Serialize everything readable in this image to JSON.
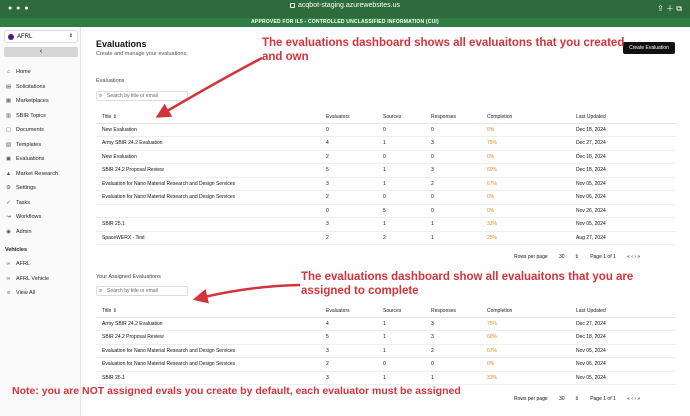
{
  "browser": {
    "url": "acqbot-staging.azurewebsites.us"
  },
  "banner": "APPROVED FOR IL5 - CONTROLLED UNCLASSIFIED INFORMATION (CUI)",
  "sidebar": {
    "org_name": "AFRL",
    "collapse_icon": "chevron-left",
    "items": [
      {
        "label": "Home",
        "icon": "home-icon"
      },
      {
        "label": "Solicitations",
        "icon": "document-icon"
      },
      {
        "label": "Marketplaces",
        "icon": "store-icon"
      },
      {
        "label": "SBIR Topics",
        "icon": "book-icon"
      },
      {
        "label": "Documents",
        "icon": "file-icon"
      },
      {
        "label": "Templates",
        "icon": "template-icon"
      },
      {
        "label": "Evaluations",
        "icon": "clipboard-icon"
      },
      {
        "label": "Market Research",
        "icon": "chart-icon"
      },
      {
        "label": "Settings",
        "icon": "gear-icon"
      },
      {
        "label": "Tasks",
        "icon": "check-icon"
      },
      {
        "label": "Workflows",
        "icon": "workflow-icon"
      },
      {
        "label": "Admin",
        "icon": "user-icon"
      }
    ],
    "vehicles_label": "Vehicles",
    "vehicles": [
      {
        "label": "AFRL",
        "icon": "link-icon"
      },
      {
        "label": "AFRL Vehicle",
        "icon": "link-icon"
      },
      {
        "label": "View All",
        "icon": "list-icon"
      }
    ]
  },
  "header": {
    "title": "Evaluations",
    "subtitle": "Create and manage your evaluations.",
    "create_button": "Create Evaluation"
  },
  "evaluations": {
    "label": "Evaluations",
    "search_placeholder": "Search by title or email",
    "columns": [
      "Title",
      "Evaluators",
      "Sources",
      "Responses",
      "Completion",
      "Last Updated"
    ],
    "rows": [
      [
        "New Evaluation",
        "0",
        "0",
        "0",
        "0%",
        "Dec 18, 2024"
      ],
      [
        "Army SBIR 24.2 Evaluation",
        "4",
        "1",
        "3",
        "75%",
        "Dec 27, 2024"
      ],
      [
        "New Evaluation",
        "2",
        "0",
        "0",
        "0%",
        "Dec 18, 2024"
      ],
      [
        "SBIR 24.2 Proposal Review",
        "5",
        "1",
        "3",
        "60%",
        "Dec 18, 2024"
      ],
      [
        "Evaluation for Nano Material Research and Design Services",
        "3",
        "1",
        "2",
        "67%",
        "Nov 05, 2024"
      ],
      [
        "Evaluation for Nano Material Research and Design Services",
        "2",
        "0",
        "0",
        "0%",
        "Nov 06, 2024"
      ],
      [
        "",
        "0",
        "5",
        "0",
        "0%",
        "Nov 26, 2024"
      ],
      [
        "SBIR 25.1",
        "3",
        "1",
        "1",
        "33%",
        "Nov 05, 2024"
      ],
      [
        "SpaceWERX - Test",
        "2",
        "2",
        "1",
        "25%",
        "Aug 27, 2024"
      ]
    ],
    "pager": {
      "rows_label": "Rows per page",
      "rows_value": "30",
      "page": "Page 1 of 1"
    }
  },
  "assigned": {
    "label": "Your Assigned Evaluations",
    "search_placeholder": "Search by title or email",
    "columns": [
      "Title",
      "Evaluators",
      "Sources",
      "Responses",
      "Completion",
      "Last Updated"
    ],
    "rows": [
      [
        "Army SBIR 24.2 Evaluation",
        "4",
        "1",
        "3",
        "75%",
        "Dec 27, 2024"
      ],
      [
        "SBIR 24.2 Proposal Review",
        "5",
        "1",
        "3",
        "60%",
        "Dec 18, 2024"
      ],
      [
        "Evaluation for Nano Material Research and Design Services",
        "3",
        "1",
        "2",
        "67%",
        "Nov 05, 2024"
      ],
      [
        "Evaluation for Nano Material Research and Design Services",
        "2",
        "0",
        "0",
        "0%",
        "Nov 06, 2024"
      ],
      [
        "SBIR 25.1",
        "3",
        "1",
        "1",
        "33%",
        "Nov 05, 2024"
      ]
    ],
    "pager": {
      "rows_label": "Rows per page",
      "rows_value": "30",
      "page": "Page 1 of 1"
    }
  },
  "annotations": {
    "top": "The evaluations dashboard shows all evaluaitons that you created and own",
    "middle": "The evaluations dashboard show all evaluaitons that you are assigned to complete",
    "note": "Note: you are NOT assigned evals you create by default, each evaluator must be assigned",
    "color": "#d2343b"
  }
}
